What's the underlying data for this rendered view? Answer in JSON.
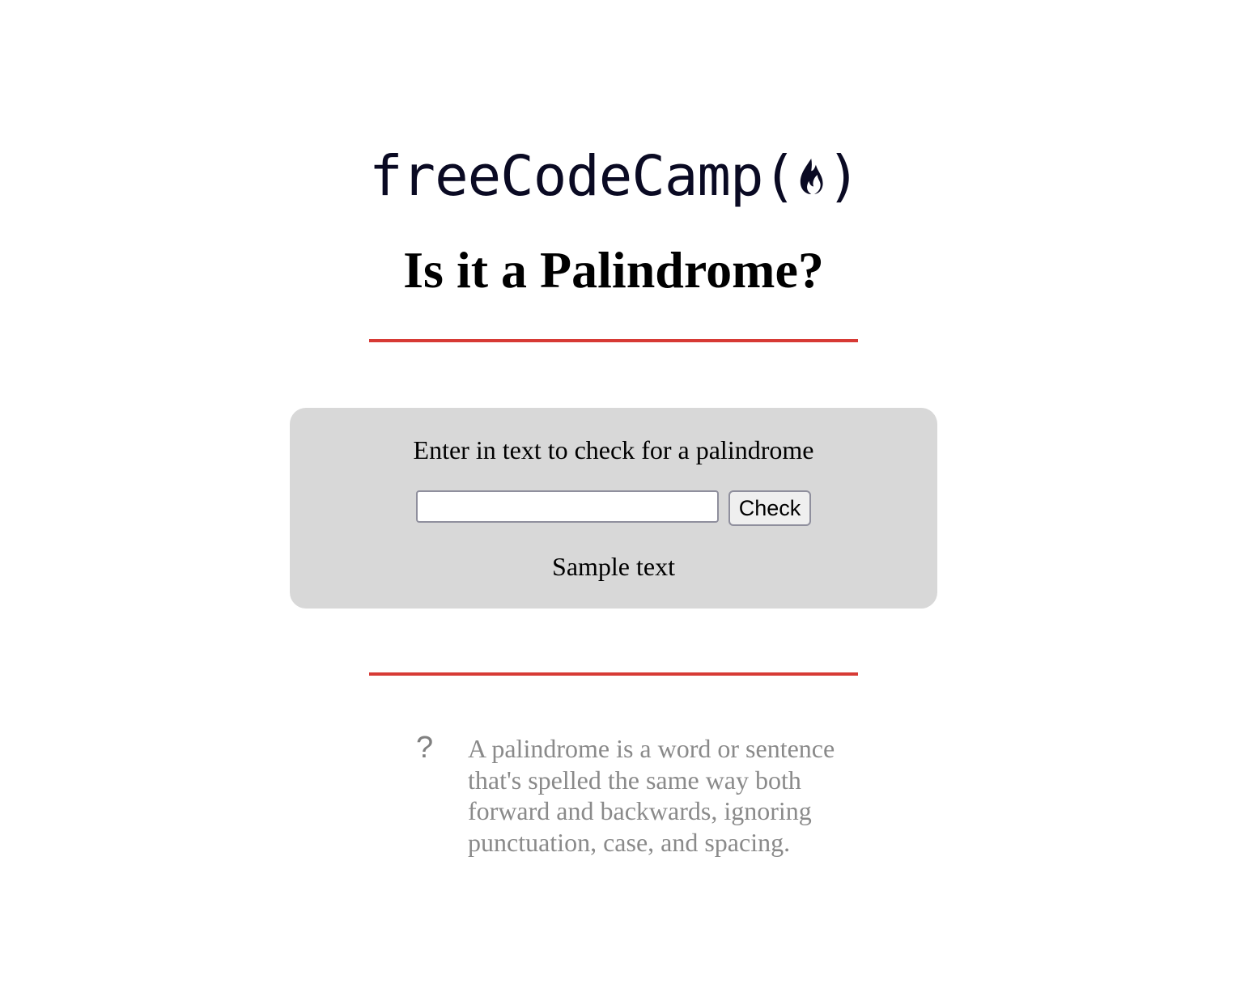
{
  "logo": {
    "text_before": "freeCodeCamp(",
    "text_after": ")",
    "icon": "flame-icon",
    "color": "#0a0a23"
  },
  "header": {
    "title": "Is it a Palindrome?"
  },
  "accent_color": "#d73a35",
  "checker": {
    "label": "Enter in text to check for a palindrome",
    "input_value": "",
    "button_label": "Check",
    "result_text": "Sample text",
    "panel_color": "#d8d8d8"
  },
  "info": {
    "icon": "question-icon",
    "icon_glyph": "?",
    "text": "A palindrome is a word or sentence that's spelled the same way both forward and backwards, ignoring punctuation, case, and spacing."
  }
}
